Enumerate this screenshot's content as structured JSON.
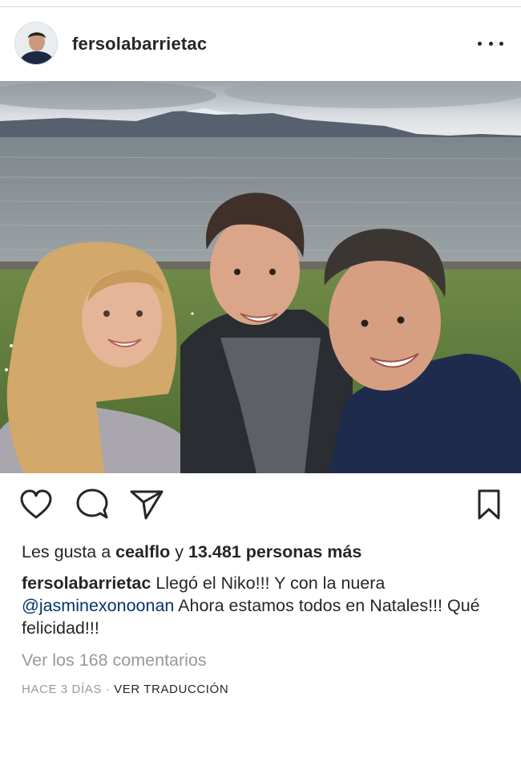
{
  "post": {
    "username": "fersolabarrietac",
    "more_icon": "more-horizontal-icon"
  },
  "photo": {
    "colors": {
      "sky": "#d7dbdf",
      "mountain": "#56606e",
      "water": "#8f979c",
      "grass": "#5c7a3a"
    }
  },
  "actions": {
    "icons": [
      "heart-icon",
      "comment-icon",
      "share-icon",
      "bookmark-icon"
    ]
  },
  "likes": {
    "prefix": "Les gusta a ",
    "user": "cealflo",
    "middle": " y ",
    "count_text": "13.481 personas más"
  },
  "caption": {
    "user": "fersolabarrietac",
    "text_1": " Llegó el Niko!!! Y con la nuera ",
    "mention": "@jasminexonoonan",
    "text_2": " Ahora estamos todos en Natales!!! Qué felicidad!!!"
  },
  "comments": {
    "view_all": "Ver los 168 comentarios"
  },
  "meta": {
    "time": "HACE 3 DÍAS",
    "separator": " · ",
    "translate": "VER TRADUCCIÓN"
  }
}
